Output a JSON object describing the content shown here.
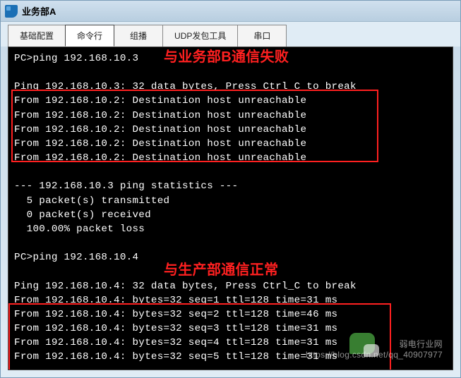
{
  "window": {
    "title": "业务部A"
  },
  "tabs": [
    {
      "label": "基础配置"
    },
    {
      "label": "命令行"
    },
    {
      "label": "组播"
    },
    {
      "label": "UDP发包工具"
    },
    {
      "label": "串口"
    }
  ],
  "terminal": {
    "lines": [
      "PC>ping 192.168.10.3",
      "",
      "Ping 192.168.10.3: 32 data bytes, Press Ctrl_C to break",
      "From 192.168.10.2: Destination host unreachable",
      "From 192.168.10.2: Destination host unreachable",
      "From 192.168.10.2: Destination host unreachable",
      "From 192.168.10.2: Destination host unreachable",
      "From 192.168.10.2: Destination host unreachable",
      "",
      "--- 192.168.10.3 ping statistics ---",
      "  5 packet(s) transmitted",
      "  0 packet(s) received",
      "  100.00% packet loss",
      "",
      "PC>ping 192.168.10.4",
      "",
      "Ping 192.168.10.4: 32 data bytes, Press Ctrl_C to break",
      "From 192.168.10.4: bytes=32 seq=1 ttl=128 time=31 ms",
      "From 192.168.10.4: bytes=32 seq=2 ttl=128 time=46 ms",
      "From 192.168.10.4: bytes=32 seq=3 ttl=128 time=31 ms",
      "From 192.168.10.4: bytes=32 seq=4 ttl=128 time=31 ms",
      "From 192.168.10.4: bytes=32 seq=5 ttl=128 time=31 ms"
    ]
  },
  "annotations": {
    "ann1": "与业务部B通信失败",
    "ann2": "与生产部通信正常"
  },
  "watermark": {
    "line1": "弱电行业网",
    "line2": "https://blog.csdn.net/qq_40907977"
  }
}
